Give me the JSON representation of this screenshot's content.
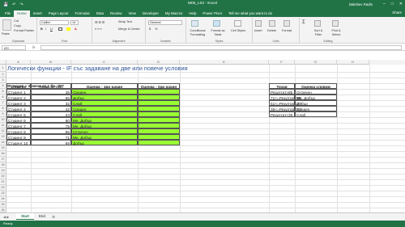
{
  "window": {
    "title": "M05_L02 - Excel",
    "user": "Bakshev Radin"
  },
  "qat": {
    "save": "💾",
    "undo": "↶",
    "redo": "↷"
  },
  "window_controls": {
    "minimize": "–",
    "maximize": "□",
    "close": "✕"
  },
  "tabs": [
    {
      "label": "File",
      "active": false
    },
    {
      "label": "Home",
      "active": true
    },
    {
      "label": "Insert",
      "active": false
    },
    {
      "label": "Page Layout",
      "active": false
    },
    {
      "label": "Formulas",
      "active": false
    },
    {
      "label": "Data",
      "active": false
    },
    {
      "label": "Review",
      "active": false
    },
    {
      "label": "View",
      "active": false
    },
    {
      "label": "Developer",
      "active": false
    },
    {
      "label": "My Macros",
      "active": false
    },
    {
      "label": "Help",
      "active": false
    },
    {
      "label": "Power Pivot",
      "active": false
    }
  ],
  "tell_me": "Tell me what you want to do",
  "share": "Share",
  "ribbon": {
    "clipboard": {
      "paste": "Paste",
      "cut": "Cut",
      "copy": "Copy",
      "format_painter": "Format Painter",
      "label": "Clipboard"
    },
    "font": {
      "name": "Calibri",
      "size": "14",
      "label": "Font",
      "bold": "B",
      "italic": "I",
      "underline": "U"
    },
    "alignment": {
      "wrap": "Wrap Text",
      "merge": "Merge & Center",
      "label": "Alignment"
    },
    "number": {
      "format": "General",
      "label": "Number",
      "currency": "$",
      "percent": "%"
    },
    "styles": {
      "conditional": "Conditional Formatting",
      "format_table": "Format as Table",
      "cell_styles": "Cell Styles",
      "label": "Styles"
    },
    "cells": {
      "insert": "Insert",
      "delete": "Delete",
      "format": "Format",
      "label": "Cells"
    },
    "editing": {
      "sort": "Sort & Filter",
      "find": "Find & Select",
      "label": "Editing"
    }
  },
  "formula_bar": {
    "name_box": "I20",
    "fx": "fx",
    "value": ""
  },
  "columns": [
    "A",
    "B",
    "C",
    "D",
    "E",
    "F",
    "G",
    "H"
  ],
  "rows": [
    "1",
    "2",
    "3",
    "4",
    "5",
    "6",
    "7",
    "8",
    "9",
    "10",
    "11",
    "12",
    "13",
    "14",
    "15",
    "16",
    "17",
    "18",
    "19",
    "20",
    "21",
    "22",
    "23",
    "24",
    "25",
    "26"
  ],
  "sheet": {
    "title": "Логически функции - IF със задаване на две или повече условия",
    "subtitle": "Функция с повече от 1 бр. \"IF\"",
    "headers": {
      "list": "Списък",
      "points": "Точки от тест",
      "grade1": "Оценка - 1ви начин",
      "grade2": "Оценка - 2ри начин"
    },
    "students": [
      {
        "name": "Студент 1",
        "points": "35",
        "grade": "Среден"
      },
      {
        "name": "Студент 2",
        "points": "66",
        "grade": "Добър"
      },
      {
        "name": "Студент 3",
        "points": "32",
        "grade": "Слаб"
      },
      {
        "name": "Студент 4",
        "points": "42",
        "grade": "Среден"
      },
      {
        "name": "Студент 5",
        "points": "23",
        "grade": "Слаб"
      },
      {
        "name": "Студент 6",
        "points": "80",
        "grade": "Мн. Добър"
      },
      {
        "name": "Студент 7",
        "points": "75",
        "grade": "Мн. Добър"
      },
      {
        "name": "Студент 8",
        "points": "95",
        "grade": "Отличен"
      },
      {
        "name": "Студент 9",
        "points": "71",
        "grade": "Мн. Добър"
      },
      {
        "name": "Студент 10",
        "points": "69",
        "grade": "Добър"
      }
    ],
    "legend_headers": {
      "points": "Точки",
      "grade": "Оценка словом"
    },
    "legend": [
      {
        "cond": "Резултат>85",
        "grade": "Отличен"
      },
      {
        "cond": "71<=Резултат<85",
        "grade": "Мн. Добър"
      },
      {
        "cond": "51<=Резултат<70",
        "grade": "Добър"
      },
      {
        "cond": "35<=Резултат<50",
        "grade": "Среден"
      },
      {
        "cond": "Резултат<35",
        "grade": "Слаб"
      }
    ]
  },
  "sheets": [
    {
      "label": "Start",
      "active": true
    },
    {
      "label": "End",
      "active": false
    }
  ],
  "add_sheet": "⊕",
  "status": "Ready",
  "colors": {
    "excel_green": "#217346",
    "highlight": "#99ff33"
  }
}
